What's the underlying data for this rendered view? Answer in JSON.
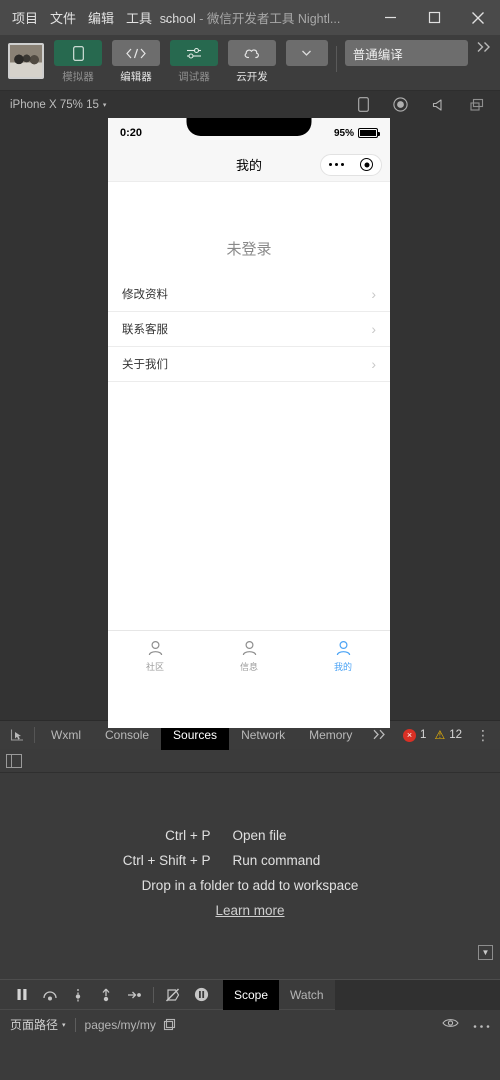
{
  "titlebar": {
    "menus": [
      "项目",
      "文件",
      "编辑",
      "工具"
    ],
    "more": "…",
    "project": "school",
    "title_rest": " - 微信开发者工具 Nightl...",
    "minimize_icon": "minimize-icon",
    "maximize_icon": "maximize-icon",
    "close_icon": "close-icon"
  },
  "toolbar": {
    "avatar_name": "user-avatar",
    "tools": [
      {
        "label": "模拟器",
        "icon": "phone-icon",
        "style": "green",
        "active": false
      },
      {
        "label": "编辑器",
        "icon": "code-icon",
        "style": "grey",
        "active": true
      },
      {
        "label": "调试器",
        "icon": "sliders-icon",
        "style": "green",
        "active": false
      },
      {
        "label": "云开发",
        "icon": "cloud-icon",
        "style": "grey",
        "active": true
      }
    ],
    "dropdown_icon": "chevron-down-icon",
    "compile_label": "普通编译",
    "overflow_icon": "double-chevron-right-icon"
  },
  "devicebar": {
    "device": "iPhone X 75% 15",
    "caret": "▾",
    "icons": [
      "phone-outline-icon",
      "record-icon",
      "volume-icon",
      "windows-icon"
    ]
  },
  "simulator": {
    "status": {
      "time": "0:20",
      "battery_pct": "95%",
      "battery_icon": "battery-icon"
    },
    "navbar": {
      "title": "我的",
      "menu_icon": "more-dots-icon",
      "target_icon": "capsule-target-icon"
    },
    "page": {
      "heading": "未登录",
      "cells": [
        {
          "label": "修改资料",
          "arrow": "›"
        },
        {
          "label": "联系客服",
          "arrow": "›"
        },
        {
          "label": "关于我们",
          "arrow": "›"
        }
      ]
    },
    "tabbar": [
      {
        "label": "社区",
        "icon": "person-icon",
        "active": false
      },
      {
        "label": "信息",
        "icon": "person-icon",
        "active": false
      },
      {
        "label": "我的",
        "icon": "person-icon",
        "active": true
      }
    ],
    "accent": "#4ba3f5"
  },
  "devtools": {
    "inspect_icon": "inspect-cursor-icon",
    "tabs": [
      "Wxml",
      "Console",
      "Sources",
      "Network",
      "Memory"
    ],
    "selected_tab": "Sources",
    "more_icon": "double-chevron-right-icon",
    "error_count": "1",
    "warning_count": "12",
    "error_icon": "error-icon",
    "warning_icon": "warning-icon",
    "kebab_icon": "kebab-menu-icon",
    "panel_icon": "side-panel-icon",
    "sources_empty": {
      "shortcuts": [
        {
          "key": "Ctrl + P",
          "desc": "Open file"
        },
        {
          "key": "Ctrl + Shift + P",
          "desc": "Run command"
        }
      ],
      "drop_hint": "Drop in a folder to add to workspace",
      "learn_more": "Learn more"
    },
    "collapse_icon": "collapse-down-icon",
    "debug_icons": [
      "pause-icon",
      "step-over-icon",
      "step-into-icon",
      "step-out-icon",
      "step-icon",
      "deactivate-breakpoints-icon",
      "pause-on-exceptions-icon"
    ],
    "scope_tabs": [
      "Scope",
      "Watch"
    ],
    "scope_selected": "Scope"
  },
  "statusline": {
    "label": "页面路径",
    "caret": "▾",
    "path": "pages/my/my",
    "copy_icon": "copy-icon",
    "eye_icon": "eye-icon",
    "ellipsis_icon": "ellipsis-icon"
  },
  "colors": {
    "accent_green": "#27694f",
    "accent_blue": "#4ba3f5",
    "error_red": "#d93025",
    "warning_yellow": "#f5bb00"
  }
}
